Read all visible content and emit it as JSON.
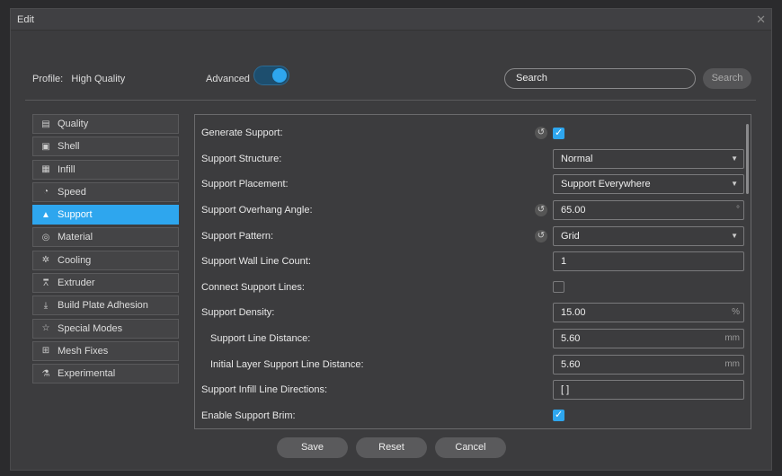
{
  "window": {
    "title": "Edit",
    "close_glyph": "✕"
  },
  "profile": {
    "label": "Profile:",
    "value": "High Quality"
  },
  "advanced": {
    "label": "Advanced",
    "enabled": true
  },
  "search": {
    "placeholder": "Search",
    "value": "Search",
    "button_label": "Search"
  },
  "sidebar": {
    "items": [
      {
        "label": "Quality",
        "icon": "quality-icon",
        "glyph": "▤",
        "active": false
      },
      {
        "label": "Shell",
        "icon": "shell-icon",
        "glyph": "▣",
        "active": false
      },
      {
        "label": "Infill",
        "icon": "infill-icon",
        "glyph": "▦",
        "active": false
      },
      {
        "label": "Speed",
        "icon": "speed-icon",
        "glyph": "◔",
        "active": false
      },
      {
        "label": "Support",
        "icon": "support-icon",
        "glyph": "▲",
        "active": true
      },
      {
        "label": "Material",
        "icon": "material-icon",
        "glyph": "◎",
        "active": false
      },
      {
        "label": "Cooling",
        "icon": "cooling-icon",
        "glyph": "✲",
        "active": false
      },
      {
        "label": "Extruder",
        "icon": "extruder-icon",
        "glyph": "⩞",
        "active": false
      },
      {
        "label": "Build Plate Adhesion",
        "icon": "build-plate-icon",
        "glyph": "⤓",
        "active": false
      },
      {
        "label": "Special Modes",
        "icon": "special-modes-icon",
        "glyph": "☆",
        "active": false
      },
      {
        "label": "Mesh Fixes",
        "icon": "mesh-fixes-icon",
        "glyph": "⊞",
        "active": false
      },
      {
        "label": "Experimental",
        "icon": "experimental-icon",
        "glyph": "⚗",
        "active": false
      }
    ]
  },
  "settings": [
    {
      "label": "Generate Support:",
      "type": "checkbox",
      "checked": true,
      "reset": true
    },
    {
      "label": "Support Structure:",
      "type": "select",
      "value": "Normal"
    },
    {
      "label": "Support Placement:",
      "type": "select",
      "value": "Support Everywhere"
    },
    {
      "label": "Support Overhang Angle:",
      "type": "input",
      "value": "65.00",
      "unit": "°",
      "reset": true
    },
    {
      "label": "Support Pattern:",
      "type": "select",
      "value": "Grid",
      "reset": true
    },
    {
      "label": "Support Wall Line Count:",
      "type": "input",
      "value": "1",
      "unit": ""
    },
    {
      "label": "Connect Support Lines:",
      "type": "checkbox",
      "checked": false
    },
    {
      "label": "Support Density:",
      "type": "input",
      "value": "15.00",
      "unit": "%"
    },
    {
      "label": "Support Line Distance:",
      "type": "input",
      "value": "5.60",
      "unit": "mm",
      "indent": true
    },
    {
      "label": "Initial Layer Support Line Distance:",
      "type": "input",
      "value": "5.60",
      "unit": "mm",
      "indent": true
    },
    {
      "label": "Support Infill Line Directions:",
      "type": "input",
      "value": "[ ]",
      "unit": ""
    },
    {
      "label": "Enable Support Brim:",
      "type": "checkbox",
      "checked": true
    }
  ],
  "footer": {
    "save_label": "Save",
    "reset_label": "Reset",
    "cancel_label": "Cancel"
  },
  "colors": {
    "accent": "#2ea6ee",
    "background": "#3c3c3e"
  }
}
